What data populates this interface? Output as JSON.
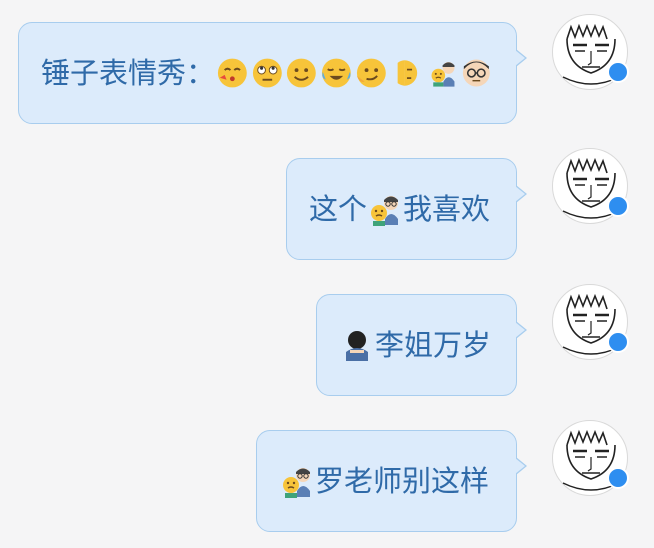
{
  "messages": [
    {
      "id": "m1",
      "text": "锤子表情秀：",
      "emojis": [
        "kiss-face-icon",
        "rolling-eyes-face-icon",
        "smile-face-icon",
        "crying-laughing-face-icon",
        "smirk-face-icon",
        "side-eye-face-icon",
        "sad-person-icon",
        "glasses-person-icon",
        "glasses-face-icon"
      ]
    },
    {
      "id": "m2",
      "text_before": "这个",
      "text_after": "我喜欢",
      "emojis": [
        "teacher-with-student-icon"
      ]
    },
    {
      "id": "m3",
      "text": "李姐万岁",
      "emojis": [
        "bowing-person-icon"
      ]
    },
    {
      "id": "m4",
      "text": "罗老师别这样",
      "emojis": [
        "teacher-with-student-icon"
      ]
    }
  ],
  "colors": {
    "bubble_bg": "#dcebfb",
    "bubble_border": "#a8cdee",
    "text": "#2f6aa8",
    "badge": "#2e8ef0",
    "page_bg": "#f5f5f6"
  }
}
